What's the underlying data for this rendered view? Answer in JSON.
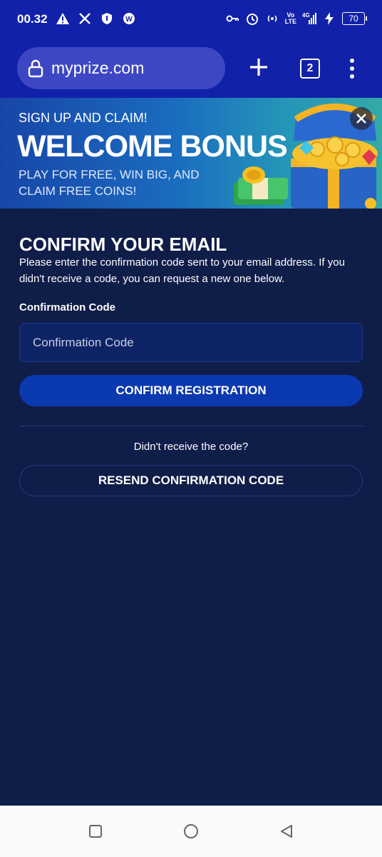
{
  "status_bar": {
    "time": "00.32",
    "network_label": "Vo\nLTE",
    "net_type": "4G",
    "battery": "70"
  },
  "browser": {
    "url": "myprize.com",
    "tab_count": "2"
  },
  "banner": {
    "subtitle": "SIGN UP AND CLAIM!",
    "title": "WELCOME BONUS",
    "description": "PLAY FOR FREE, WIN BIG, AND CLAIM FREE COINS!"
  },
  "form": {
    "title": "CONFIRM YOUR EMAIL",
    "description": "Please enter the confirmation code sent to your email address. If you didn't receive a code, you can request a new one below.",
    "field_label": "Confirmation Code",
    "field_placeholder": "Confirmation Code",
    "field_value": "",
    "confirm_label": "CONFIRM REGISTRATION",
    "resend_hint": "Didn't receive the code?",
    "resend_label": "RESEND CONFIRMATION CODE"
  },
  "colors": {
    "browser_bar": "#1221a9",
    "page_bg": "#0f1d49",
    "primary_button": "#0a39b0"
  }
}
